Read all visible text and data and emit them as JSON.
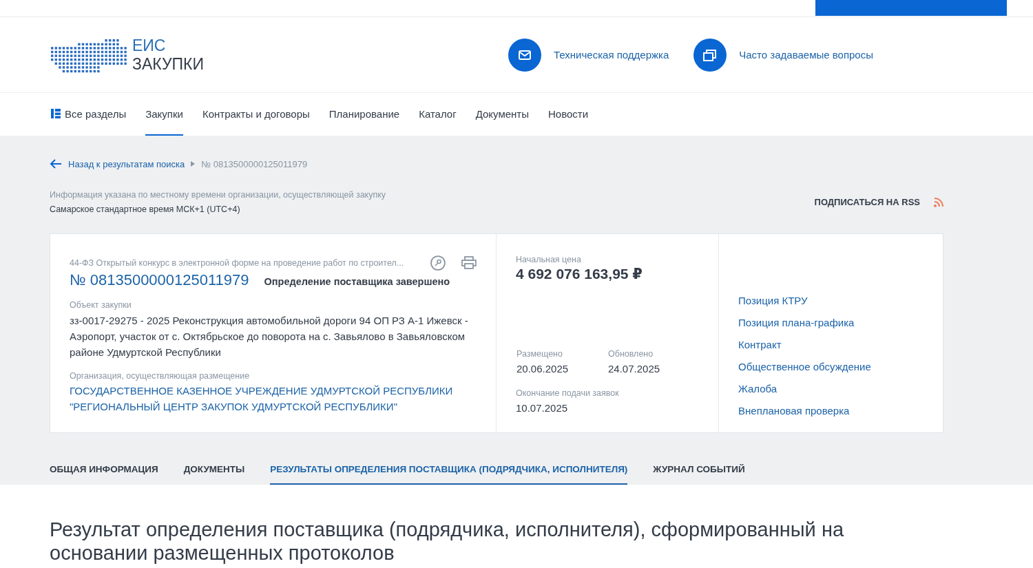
{
  "header": {
    "logo": {
      "line1": "ЕИС",
      "line2": "ЗАКУПКИ"
    },
    "links": [
      {
        "label": "Техническая поддержка",
        "kind": "mail"
      },
      {
        "label": "Часто задаваемые вопросы",
        "kind": "faq"
      }
    ]
  },
  "nav": [
    {
      "label": "Все разделы",
      "kind": "sections",
      "selected": false
    },
    {
      "label": "Закупки",
      "selected": true
    },
    {
      "label": "Контракты и договоры",
      "selected": false
    },
    {
      "label": "Планирование",
      "selected": false
    },
    {
      "label": "Каталог",
      "selected": false
    },
    {
      "label": "Документы",
      "selected": false
    },
    {
      "label": "Новости",
      "selected": false
    }
  ],
  "breadcrumb": {
    "back": "Назад к результатам поиска",
    "current": "№ 0813500000125011979"
  },
  "timezone": {
    "note": "Информация указана по местному времени организации, осуществляющей закупку",
    "zone": "Самарское стандартное время МСК+1 (UTC+4)"
  },
  "rss": "ПОДПИСАТЬСЯ НА RSS",
  "card": {
    "type": "44-ФЗ Открытый конкурс в электронной форме на проведение работ по строител...",
    "number": "№ 0813500000125011979",
    "status": "Определение поставщика завершено",
    "object_label": "Объект закупки",
    "object": "зз-0017-29275 - 2025 Реконструкция автомобильной дороги 94 ОП РЗ А-1 Ижевск - Аэропорт, участок от с. Октябрьское до поворота на с. Завьялово в Завьяловском районе Удмуртской Республики",
    "org_label": "Организация, осуществляющая размещение",
    "org": "ГОСУДАРСТВЕННОЕ КАЗЕННОЕ УЧРЕЖДЕНИЕ УДМУРТСКОЙ РЕСПУБЛИКИ \"РЕГИОНАЛЬНЫЙ ЦЕНТР ЗАКУПОК УДМУРТСКОЙ РЕСПУБЛИКИ\"",
    "price_label": "Начальная цена",
    "price": "4 692 076 163,95 ₽",
    "dates": [
      {
        "label": "Размещено",
        "value": "20.06.2025"
      },
      {
        "label": "Обновлено",
        "value": "24.07.2025"
      }
    ],
    "deadline_label": "Окончание подачи заявок",
    "deadline": "10.07.2025",
    "links": [
      "Позиция КТРУ",
      "Позиция плана-графика",
      "Контракт",
      "Общественное обсуждение",
      "Жалоба",
      "Внеплановая проверка"
    ]
  },
  "tabs": [
    {
      "label": "ОБЩАЯ ИНФОРМАЦИЯ",
      "selected": false
    },
    {
      "label": "ДОКУМЕНТЫ",
      "selected": false
    },
    {
      "label": "РЕЗУЛЬТАТЫ ОПРЕДЕЛЕНИЯ ПОСТАВЩИКА (ПОДРЯДЧИКА, ИСПОЛНИТЕЛЯ)",
      "selected": true
    },
    {
      "label": "ЖУРНАЛ СОБЫТИЙ",
      "selected": false
    }
  ],
  "heading": "Результат определения поставщика (подрядчика, исполнителя), сформированный на основании размещенных протоколов"
}
